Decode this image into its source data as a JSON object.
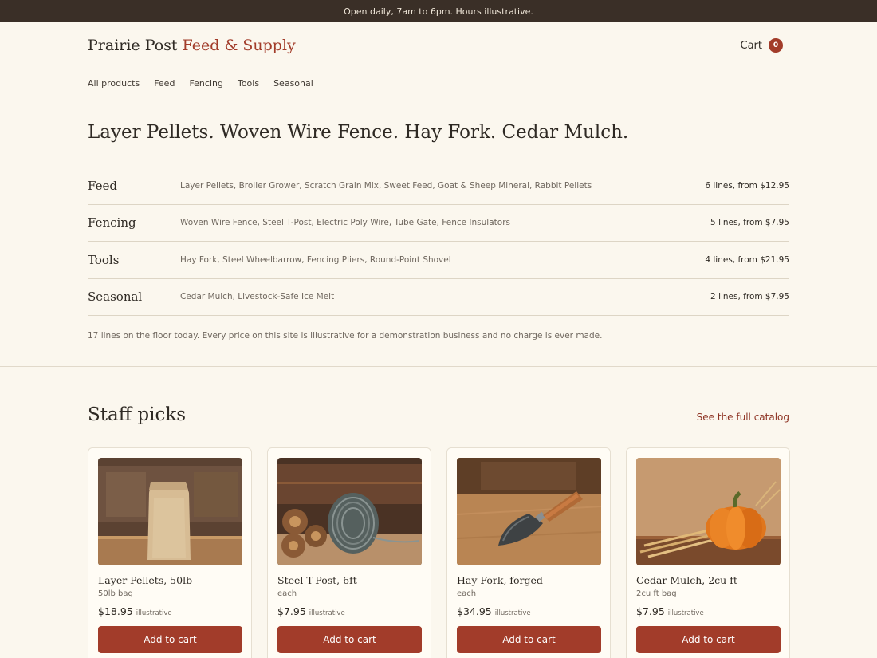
{
  "announcement": "Open daily, 7am to 6pm. Hours illustrative.",
  "brand": {
    "name": "Prairie Post",
    "accent": "Feed & Supply"
  },
  "cart": {
    "label": "Cart",
    "count": "0"
  },
  "nav": [
    "All products",
    "Feed",
    "Fencing",
    "Tools",
    "Seasonal"
  ],
  "hero": {
    "title": "Layer Pellets. Woven Wire Fence. Hay Fork. Cedar Mulch.",
    "categories": [
      {
        "name": "Feed",
        "items": "Layer Pellets, Broiler Grower, Scratch Grain Mix, Sweet Feed, Goat & Sheep Mineral, Rabbit Pellets",
        "meta": "6 lines, from $12.95"
      },
      {
        "name": "Fencing",
        "items": "Woven Wire Fence, Steel T-Post, Electric Poly Wire, Tube Gate, Fence Insulators",
        "meta": "5 lines, from $7.95"
      },
      {
        "name": "Tools",
        "items": "Hay Fork, Steel Wheelbarrow, Fencing Pliers, Round-Point Shovel",
        "meta": "4 lines, from $21.95"
      },
      {
        "name": "Seasonal",
        "items": "Cedar Mulch, Livestock-Safe Ice Melt",
        "meta": "2 lines, from $7.95"
      }
    ],
    "note": "17 lines on the floor today. Every price on this site is illustrative for a demonstration business and no charge is ever made."
  },
  "picks": {
    "title": "Staff picks",
    "link": "See the full catalog",
    "items": [
      {
        "name": "Layer Pellets, 50lb",
        "unit": "50lb bag",
        "price": "$18.95",
        "price_note": "illustrative",
        "button": "Add to cart",
        "image": "paper-feed-bag"
      },
      {
        "name": "Steel T-Post, 6ft",
        "unit": "each",
        "price": "$7.95",
        "price_note": "illustrative",
        "button": "Add to cart",
        "image": "wire-spool"
      },
      {
        "name": "Hay Fork, forged",
        "unit": "each",
        "price": "$34.95",
        "price_note": "illustrative",
        "button": "Add to cart",
        "image": "hand-trowel"
      },
      {
        "name": "Cedar Mulch, 2cu ft",
        "unit": "2cu ft bag",
        "price": "$7.95",
        "price_note": "illustrative",
        "button": "Add to cart",
        "image": "pumpkin-with-wheat"
      }
    ]
  },
  "colors": {
    "accent": "#a23c2a",
    "background": "#fbf7ee",
    "topbar": "#3a2f27"
  }
}
